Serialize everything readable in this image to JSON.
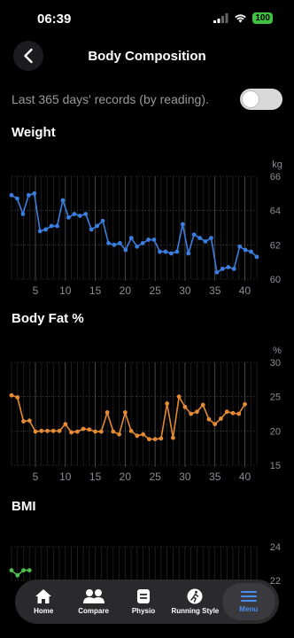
{
  "status": {
    "time": "06:39",
    "battery": "100"
  },
  "header": {
    "title": "Body Composition"
  },
  "filter": {
    "label": "Last 365 days' records (by reading).",
    "toggle_on": false
  },
  "sections": {
    "weight": {
      "title": "Weight"
    },
    "bodyfat": {
      "title": "Body Fat %"
    },
    "bmi": {
      "title": "BMI"
    }
  },
  "tabs": [
    {
      "label": "Home",
      "icon": "home-icon"
    },
    {
      "label": "Compare",
      "icon": "people-icon"
    },
    {
      "label": "Physio",
      "icon": "clipboard-icon"
    },
    {
      "label": "Running Style",
      "icon": "runner-icon"
    },
    {
      "label": "Menu",
      "icon": "menu-icon",
      "active": true
    }
  ],
  "colors": {
    "weight": "#3a7fe0",
    "bodyfat": "#e58a35",
    "bmi": "#4cc24c",
    "accent": "#4a8ef0"
  },
  "chart_data": [
    {
      "type": "line",
      "title": "Weight",
      "ylabel": "kg",
      "ylim": [
        60,
        66
      ],
      "yticks": [
        60,
        62,
        64,
        66
      ],
      "xlim": [
        1,
        42
      ],
      "xticks": [
        5,
        10,
        15,
        20,
        25,
        30,
        35,
        40
      ],
      "grid": true,
      "x": [
        1,
        2,
        3,
        4,
        5,
        6,
        7,
        8,
        9,
        10,
        11,
        12,
        13,
        14,
        15,
        16,
        17,
        18,
        19,
        20,
        21,
        22,
        23,
        24,
        25,
        26,
        27,
        28,
        29,
        30,
        31,
        32,
        33,
        34,
        35,
        36,
        37,
        38,
        39,
        40,
        41,
        42
      ],
      "values": [
        64.9,
        64.7,
        63.8,
        64.9,
        65.0,
        62.8,
        62.9,
        63.1,
        63.1,
        64.6,
        63.6,
        63.8,
        63.7,
        63.8,
        62.9,
        63.1,
        63.4,
        62.1,
        62.0,
        62.1,
        61.7,
        62.4,
        61.9,
        62.1,
        62.3,
        62.3,
        61.6,
        61.6,
        61.5,
        61.6,
        63.2,
        61.5,
        62.6,
        62.4,
        62.2,
        62.4,
        60.4,
        60.6,
        60.7,
        60.6,
        61.9,
        61.7,
        61.6,
        61.3
      ]
    },
    {
      "type": "line",
      "title": "Body Fat %",
      "ylabel": "%",
      "ylim": [
        15,
        30
      ],
      "yticks": [
        15,
        20,
        25,
        30
      ],
      "xlim": [
        1,
        42
      ],
      "xticks": [
        5,
        10,
        15,
        20,
        25,
        30,
        35,
        40
      ],
      "grid": true,
      "x": [
        1,
        2,
        3,
        4,
        5,
        6,
        7,
        8,
        9,
        10,
        11,
        12,
        13,
        14,
        15,
        16,
        17,
        18,
        19,
        20,
        21,
        22,
        23,
        24,
        25,
        26,
        27,
        28,
        29,
        30,
        31,
        32,
        33,
        34,
        35,
        36,
        37,
        38,
        39,
        40
      ],
      "values": [
        25.2,
        24.9,
        21.4,
        21.5,
        19.9,
        20.0,
        20.0,
        20.0,
        20.0,
        21.0,
        19.8,
        19.9,
        20.3,
        20.2,
        19.9,
        19.9,
        22.7,
        19.9,
        19.5,
        22.7,
        20.0,
        19.3,
        19.5,
        18.8,
        18.8,
        18.9,
        24.0,
        19.0,
        25.0,
        23.5,
        22.5,
        22.8,
        23.8,
        21.7,
        21.0,
        21.8,
        22.8,
        22.6,
        22.5,
        23.9
      ]
    },
    {
      "type": "line",
      "title": "BMI",
      "ylabel": "",
      "ylim": [
        22,
        24
      ],
      "yticks": [
        22,
        24
      ],
      "xlim": [
        1,
        42
      ],
      "grid": true,
      "x": [
        1,
        2,
        3,
        4
      ],
      "values": [
        22.6,
        22.3,
        22.6,
        22.6
      ]
    }
  ]
}
